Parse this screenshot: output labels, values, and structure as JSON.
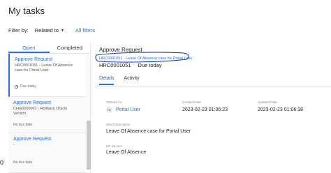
{
  "page": {
    "title": "My tasks"
  },
  "filter": {
    "label": "Filter by:",
    "selected": "Related to",
    "all_filters": "All filters"
  },
  "left_tabs": [
    {
      "label": "Open"
    },
    {
      "label": "Completed"
    }
  ],
  "tasks": [
    {
      "title": "Approve Request",
      "description": "HRC0001051 - Leave Of Absence case for Portal User",
      "due": "Due today"
    },
    {
      "title": "Approve Request",
      "description": "CHG0000001 - Rollback Oracle Version",
      "due": "No due date"
    },
    {
      "title": "Approve Request",
      "description": "-",
      "due": "No due date"
    }
  ],
  "detail": {
    "title": "Approve Request",
    "link": "HRC0001051 - Leave Of Absence case for Portal User",
    "record_number": "HRC0001051",
    "due": "Due today",
    "tabs": [
      {
        "label": "Details"
      },
      {
        "label": "Activity"
      }
    ],
    "fields": {
      "opened_for": {
        "label": "Opened for",
        "value": "Portal User",
        "avatar_initials": "PU"
      },
      "created_date": {
        "label": "Created Date",
        "value": "2023-02-23 01:06:23"
      },
      "updated_date": {
        "label": "Updated Date",
        "value": "2023-02-23 01:06:38"
      },
      "short_description": {
        "label": "Short Description",
        "value": "Leave Of Absence case for Portal User"
      },
      "hr_service": {
        "label": "HR Service",
        "value": "Leave Of Absence"
      }
    }
  },
  "misc": {
    "bottom_glyph": "0"
  },
  "colors": {
    "accent": "#2b6fd6",
    "annotation": "#1c3fa8"
  }
}
